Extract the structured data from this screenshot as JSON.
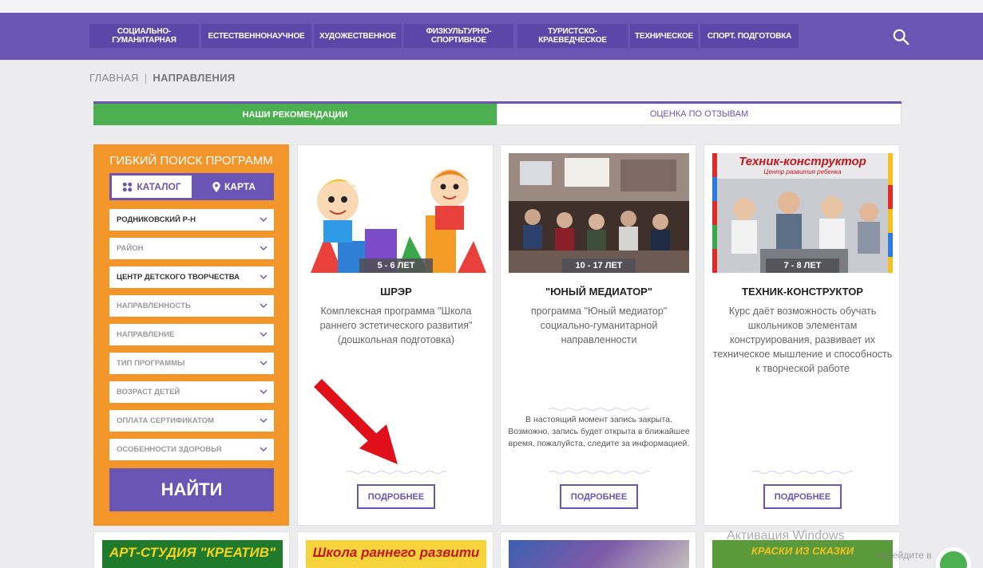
{
  "nav": {
    "items": [
      "СОЦИАЛЬНО-\nГУМАНИТАРНАЯ",
      "ЕСТЕСТВЕННОНАУЧНОЕ",
      "ХУДОЖЕСТВЕННОЕ",
      "ФИЗКУЛЬТУРНО-\nСПОРТИВНОЕ",
      "ТУРИСТСКО-\nКРАЕВЕДЧЕСКОЕ",
      "ТЕХНИЧЕСКОЕ",
      "СПОРТ. ПОДГОТОВКА"
    ],
    "search_icon": "search-icon"
  },
  "breadcrumb": {
    "home": "ГЛАВНАЯ",
    "separator": "|",
    "current": "НАПРАВЛЕНИЯ"
  },
  "tabs": {
    "recommendations": "НАШИ РЕКОМЕНДАЦИИ",
    "reviews": "ОЦЕНКА ПО ОТЗЫВАМ"
  },
  "filter": {
    "title": "ГИБКИЙ ПОИСК ПРОГРАММ",
    "catalog_label": "КАТАЛОГ",
    "map_label": "КАРТА",
    "selects": [
      "РОДНИКОВСКИЙ Р-Н",
      "РАЙОН",
      "ЦЕНТР ДЕТСКОГО ТВОРЧЕСТВА",
      "НАПРАВЛЕННОСТЬ",
      "НАПРАВЛЕНИЕ",
      "ТИП ПРОГРАММЫ",
      "ВОЗРАСТ ДЕТЕЙ",
      "ОПЛАТА СЕРТИФИКАТОМ",
      "ОСОБЕННОСТИ ЗДОРОВЬЯ"
    ],
    "find_label": "НАЙТИ"
  },
  "cards": [
    {
      "age": "5 - 6 ЛЕТ",
      "title": "ШРЭР",
      "desc": "Комплексная программа \"Школа раннего эстетического развития\" (дошкольная подготовка)",
      "note": "",
      "more": "ПОДРОБНЕЕ"
    },
    {
      "age": "10 - 17 ЛЕТ",
      "title": "\"ЮНЫЙ МЕДИАТОР\"",
      "desc": "программа \"Юный медиатор\" социально-гуманитарной направленности",
      "note": "В настоящий момент запись закрыта. Возможно, запись будет открыта в ближайшее время, пожалуйста, следите за информацией.",
      "more": "ПОДРОБНЕЕ"
    },
    {
      "age": "7 - 8 ЛЕТ",
      "title": "ТЕХНИК-КОНСТРУКТОР",
      "desc": "Курс даёт возможность обучать школьников элементам конструирования, развивает их техническое мышление и способность к творческой работе",
      "note": "",
      "more": "ПОДРОБНЕЕ",
      "image_title": "Техник-конструктор",
      "image_subtitle": "Центр развития ребенка"
    }
  ],
  "bottom_cards": [
    {
      "text": "АРТ-СТУДИЯ \"КРЕАТИВ\""
    },
    {
      "text": "Школа раннего развити"
    },
    {
      "text": ""
    },
    {
      "text": "КРАСКИ ИЗ СКАЗКИ"
    }
  ],
  "watermark": {
    "line1": "Активация Windows",
    "line2": "перейдите в"
  },
  "colors": {
    "brand_purple": "#6a55b5",
    "accent_orange": "#f2952a",
    "active_green": "#4caf50"
  }
}
